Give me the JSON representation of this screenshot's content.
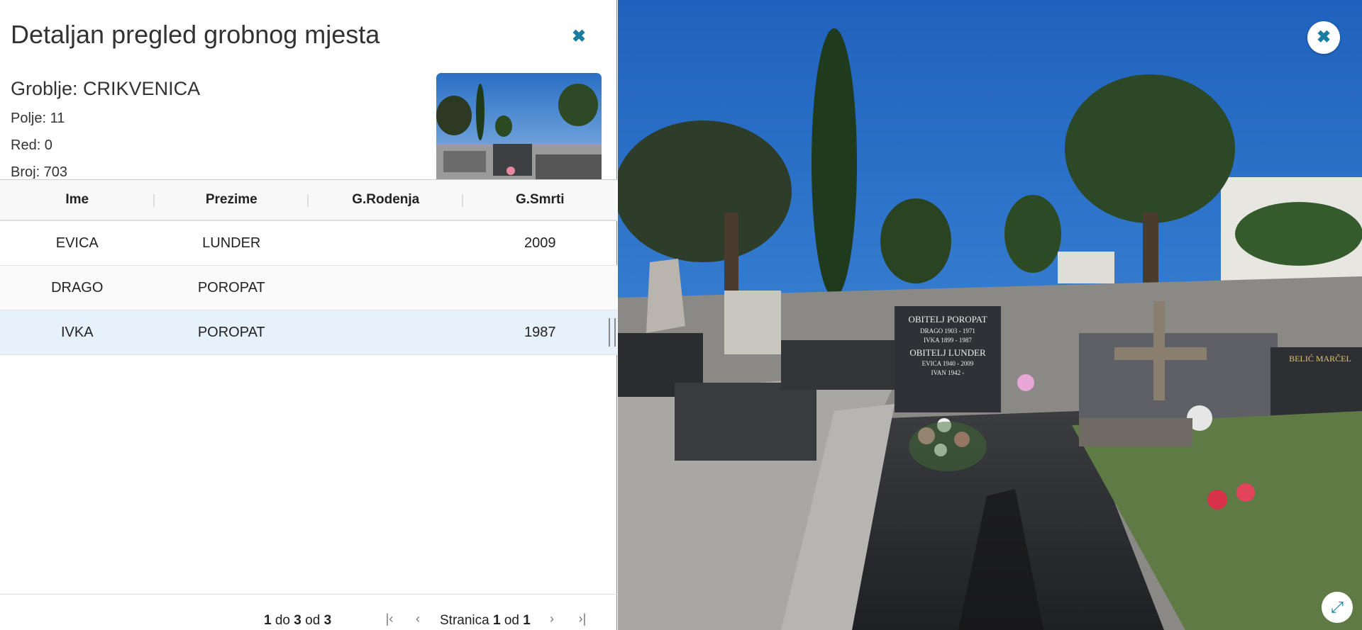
{
  "panel": {
    "title": "Detaljan pregled grobnog mjesta",
    "close_icon": "close-icon",
    "cemetery": "Groblje: CRIKVENICA",
    "field": "Polje: 11",
    "row": "Red: 0",
    "number": "Broj: 703"
  },
  "table": {
    "columns": [
      "Ime",
      "Prezime",
      "G.Rodenja",
      "G.Smrti"
    ],
    "rows": [
      {
        "ime": "EVICA",
        "prezime": "LUNDER",
        "rodenja": "",
        "smrti": "2009"
      },
      {
        "ime": "DRAGO",
        "prezime": "POROPAT",
        "rodenja": "",
        "smrti": ""
      },
      {
        "ime": "IVKA",
        "prezime": "POROPAT",
        "rodenja": "",
        "smrti": "1987"
      }
    ]
  },
  "pager": {
    "from": "1",
    "to_word": "do",
    "to": "3",
    "of_word": "od",
    "total": "3",
    "page_word": "Stranica",
    "page": "1",
    "page_of_word": "od",
    "pages": "1"
  },
  "tombstone": {
    "line1": "OBITELJ POROPAT",
    "line2": "DRAGO 1903 - 1971",
    "line3": "IVKA 1899 - 1987",
    "line4": "OBITELJ LUNDER",
    "line5": "EVICA 1940 - 2009",
    "line6": "IVAN 1942 -",
    "side_stone": "BELIĆ MARČEL"
  },
  "colors": {
    "accent": "#1a7ea0",
    "selected_row": "#e6f1fb",
    "sky": "#2f74c6"
  }
}
